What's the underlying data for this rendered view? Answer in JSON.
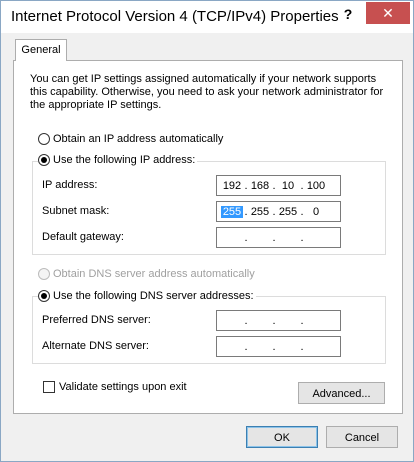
{
  "window": {
    "title": "Internet Protocol Version 4 (TCP/IPv4) Properties",
    "help": "?",
    "close": "✕"
  },
  "tabs": [
    {
      "label": "General"
    }
  ],
  "description": "You can get IP settings assigned automatically if your network supports this capability. Otherwise, you need to ask your network administrator for the appropriate IP settings.",
  "ip_section": {
    "auto_label": "Obtain an IP address automatically",
    "manual_label": "Use the following IP address:",
    "fields": [
      {
        "label": "IP address:",
        "octets": [
          "192",
          "168",
          "10",
          "100"
        ]
      },
      {
        "label": "Subnet mask:",
        "octets": [
          "255",
          "255",
          "255",
          "0"
        ]
      },
      {
        "label": "Default gateway:",
        "octets": [
          "",
          "",
          "",
          ""
        ]
      }
    ]
  },
  "dns_section": {
    "auto_label": "Obtain DNS server address automatically",
    "manual_label": "Use the following DNS server addresses:",
    "fields": [
      {
        "label": "Preferred DNS server:",
        "octets": [
          "",
          "",
          "",
          ""
        ]
      },
      {
        "label": "Alternate DNS server:",
        "octets": [
          "",
          "",
          "",
          ""
        ]
      }
    ]
  },
  "validate_label": "Validate settings upon exit",
  "buttons": {
    "advanced": "Advanced...",
    "ok": "OK",
    "cancel": "Cancel"
  }
}
